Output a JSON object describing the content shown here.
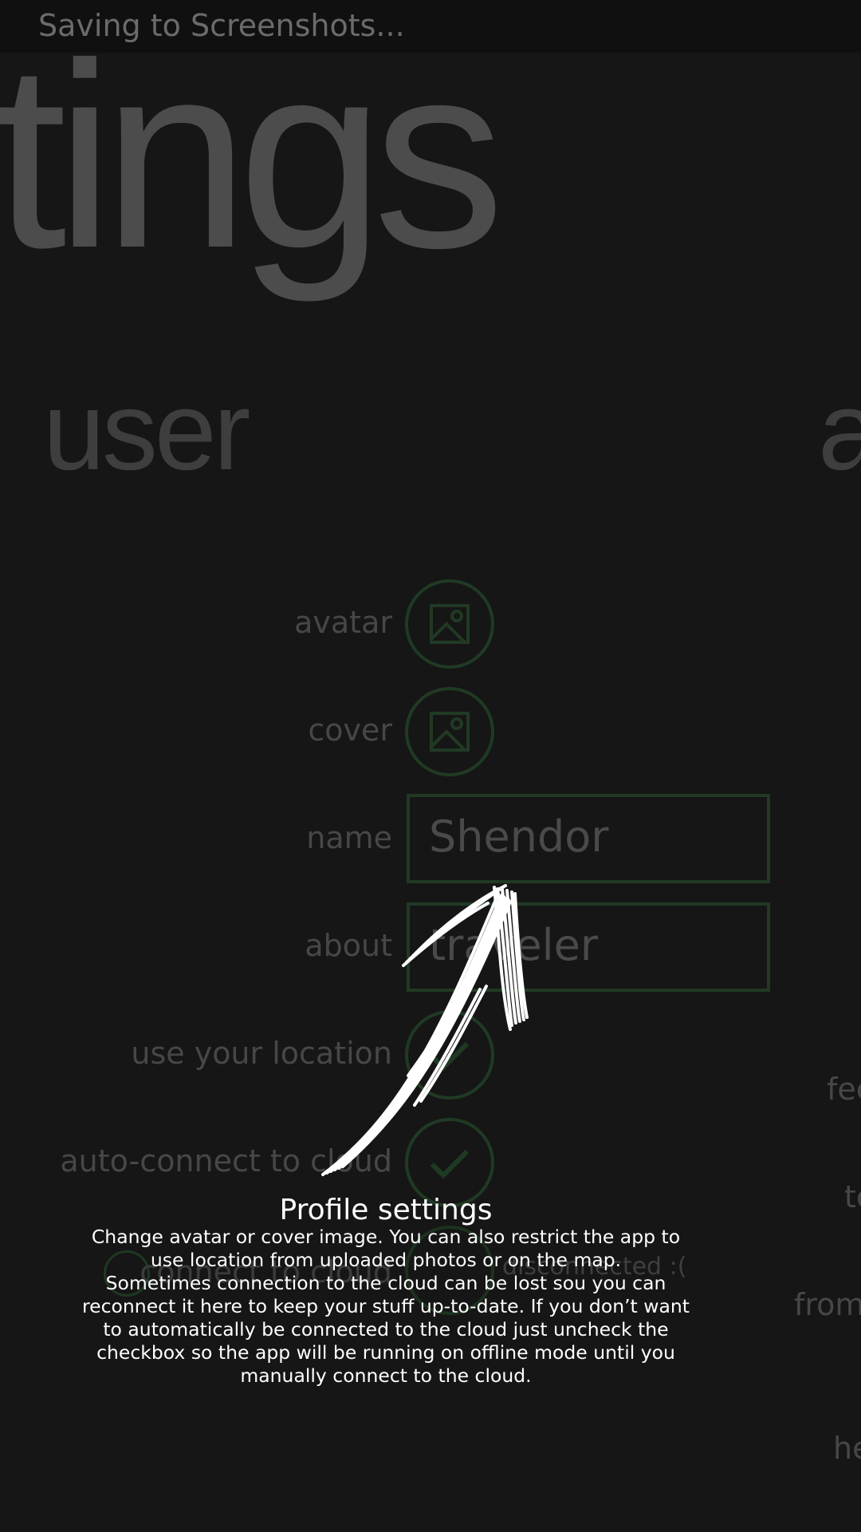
{
  "status_bar": {
    "text": "Saving to Screenshots..."
  },
  "page": {
    "title": "tings"
  },
  "pivot": {
    "current": "user",
    "next": "a"
  },
  "fields": {
    "avatar_label": "avatar",
    "cover_label": "cover",
    "name_label": "name",
    "name_value": "Shendor",
    "about_label": "about",
    "about_value": "traveler",
    "location_label": "use your location",
    "autoconnect_label": "auto-connect to cloud",
    "connect_label": "connect to cloud",
    "connection_status": "disconnected :("
  },
  "side_items": [
    "fee",
    "te",
    "from",
    "he"
  ],
  "tip": {
    "title": "Profile settings",
    "line1": "Change avatar or cover image. You can also restrict the app to use location from uploaded photos or on the map.",
    "line2": "Sometimes connection to the cloud can be lost sou you can reconnect it here to keep your stuff up-to-date. If you don’t want to automatically be connected to the cloud just uncheck the checkbox so the app will be running on offline mode until you manually connect to the cloud."
  },
  "colors": {
    "background": "#161616",
    "accent": "#203a24",
    "text_dim": "#474747",
    "tip_text": "#ffffff"
  },
  "icons": [
    "image-icon",
    "checkmark-icon",
    "info-icon",
    "arrow-icon"
  ]
}
